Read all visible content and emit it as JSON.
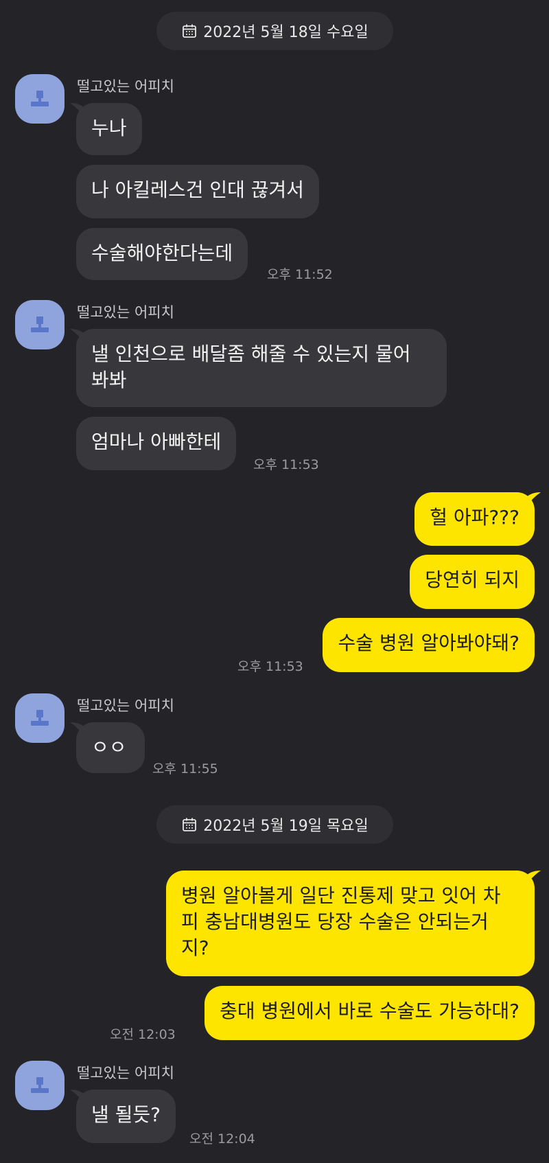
{
  "chat": {
    "date1": "2022년 5월 18일 수요일",
    "date2": "2022년 5월 19일 목요일",
    "sender": "떨고있는 어피치",
    "messages": {
      "m1": "누나",
      "m2": "나 아킬레스건 인대 끊겨서",
      "m3": "수술해야한다는데",
      "t1": "오후 11:52",
      "m4": "낼 인천으로 배달좀 해줄 수 있는지 물어\n봐봐",
      "m5": "엄마나 아빠한테",
      "t2": "오후 11:53",
      "m6": "헐 아파???",
      "m7": "당연히 되지",
      "m8": "수술 병원 알아봐야돼?",
      "t3": "오후 11:53",
      "m9": "ㅇㅇ",
      "t4": "오후 11:55",
      "m10": "병원 알아볼게 일단 진통제 맞고 잇어 차\n피 충남대병원도 당장 수술은 안되는거\n지?",
      "m11": "충대 병원에서 바로 수술도 가능하대?",
      "t5": "오전 12:03",
      "m12": "낼 될듯?",
      "t6": "오전 12:04"
    }
  },
  "colors": {
    "background": "#242428",
    "incoming_bubble": "#38383c",
    "outgoing_bubble": "#fee500",
    "avatar": "#8fa4dc",
    "timestamp": "#9b9ba0"
  },
  "icons": [
    "calendar-icon",
    "default-profile-icon"
  ]
}
